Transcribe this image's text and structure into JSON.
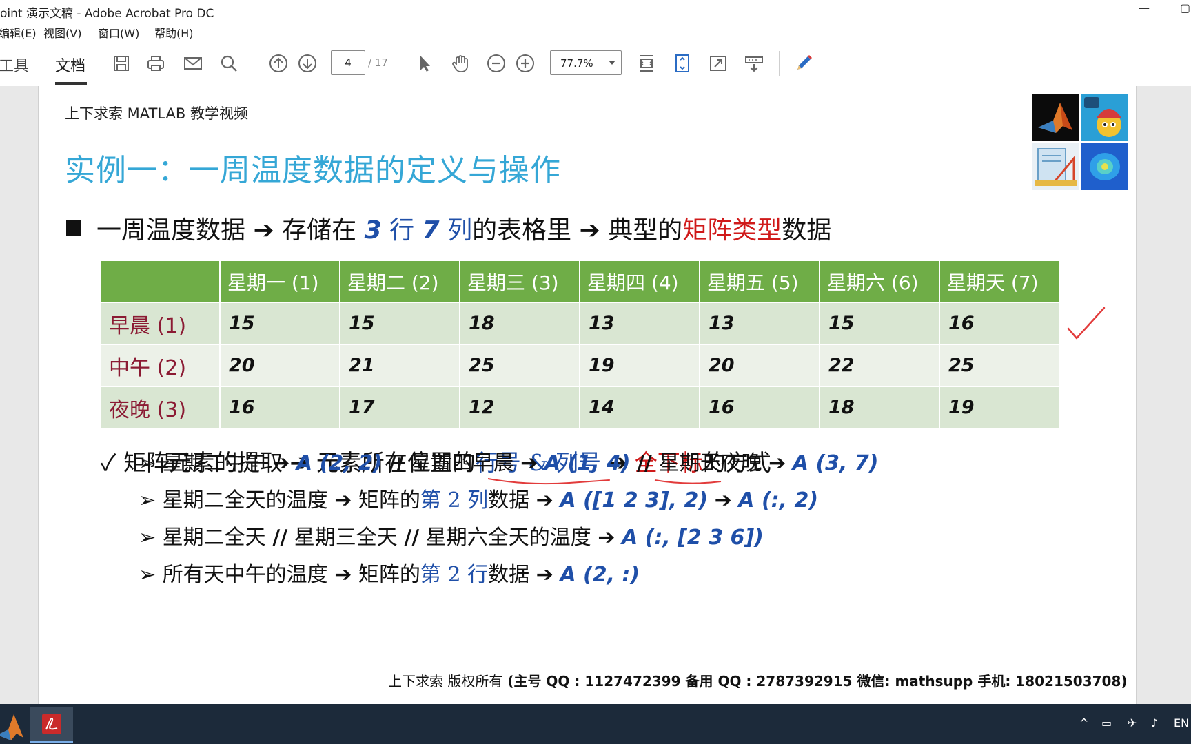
{
  "window": {
    "title": "oint 演示文稿 - Adobe Acrobat Pro DC",
    "minimize": "—",
    "maximize": "▢"
  },
  "menu": [
    "编辑(E)",
    "视图(V)",
    "窗口(W)",
    "帮助(H)"
  ],
  "toolbar": {
    "tabs": [
      "工具",
      "文档"
    ],
    "active_tab": "文档",
    "page_current": "4",
    "page_total": "/ 17",
    "zoom": "77.7%",
    "icons": [
      "save-icon",
      "print-icon",
      "email-icon",
      "search-icon",
      "page-up-icon",
      "page-down-icon",
      "select-cursor-icon",
      "hand-icon",
      "zoom-out-icon",
      "zoom-in-icon",
      "fit-width-icon",
      "fit-page-icon",
      "fullscreen-icon",
      "read-mode-icon",
      "pen-icon"
    ]
  },
  "slide": {
    "header": "上下求索 MATLAB 教学视频",
    "title": "实例一：一周温度数据的定义与操作",
    "bullet": {
      "part1": "一周温度数据",
      "arrow": "➔",
      "part2": "存储在",
      "rows": "3",
      "rows_unit": "行",
      "cols": "7",
      "cols_unit": "列",
      "part3": "的表格里",
      "part4": "典型的",
      "highlight": "矩阵类型",
      "part5": "数据"
    },
    "table": {
      "columns": [
        "",
        "星期一 (1)",
        "星期二 (2)",
        "星期三 (3)",
        "星期四 (4)",
        "星期五 (5)",
        "星期六 (6)",
        "星期天 (7)"
      ],
      "rows": [
        {
          "label": "早晨 (1)",
          "values": [
            "15",
            "15",
            "18",
            "13",
            "13",
            "15",
            "16"
          ]
        },
        {
          "label": "中午 (2)",
          "values": [
            "20",
            "21",
            "25",
            "19",
            "20",
            "22",
            "25"
          ]
        },
        {
          "label": "夜晚 (3)",
          "values": [
            "16",
            "17",
            "12",
            "14",
            "16",
            "18",
            "19"
          ]
        }
      ]
    },
    "sub": {
      "check": "✓",
      "text1": "矩阵元素的提取",
      "arrow": "➔",
      "text2": "元素所在位置的",
      "highlight_blue": "行号 & 列号",
      "highlight_red": "全下标",
      "text3": "的方式"
    },
    "items": [
      {
        "marker": "➢",
        "a": "星期二中午",
        "b": "A (2, 2)",
        "sep1": "//",
        "c": "星期四早晨",
        "d": "A (1, 4)",
        "sep2": "//",
        "e": "星期天夜晚",
        "f": "A (3, 7)"
      },
      {
        "marker": "➢",
        "a": "星期二全天的温度",
        "b": "矩阵的",
        "c": "第 2 列",
        "d": "数据",
        "e": "A ([1  2  3], 2)",
        "f": "A (:, 2)"
      },
      {
        "marker": "➢",
        "a": "星期二全天",
        "sep1": "//",
        "b": "星期三全天",
        "sep2": "//",
        "c": "星期六全天的温度",
        "d": "A (:, [2  3  6])"
      },
      {
        "marker": "➢",
        "a": "所有天中午的温度",
        "b": "矩阵的",
        "c": "第 2 行",
        "d": "数据",
        "e": "A (2, :)"
      }
    ],
    "footer": {
      "owner": "上下求索  版权所有",
      "contact": "(主号 QQ : 1127472399   备用 QQ : 2787392915   微信: mathsupp   手机: 18021503708)"
    }
  },
  "taskbar": {
    "apps": [
      "matlab-app",
      "acrobat-app"
    ],
    "lang": "EN"
  }
}
